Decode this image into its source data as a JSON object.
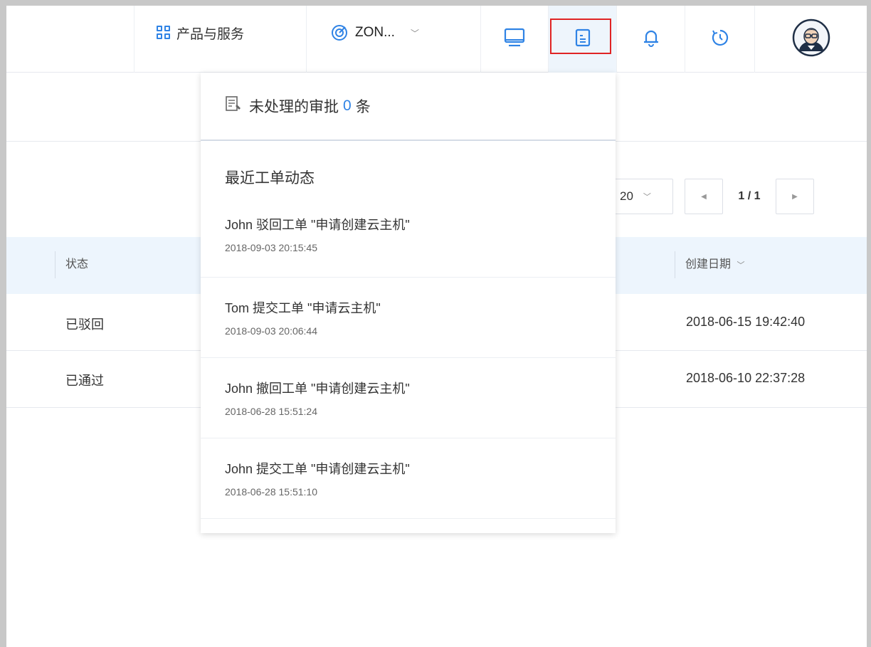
{
  "header": {
    "products_label": "产品与服务",
    "zone_label": "ZON...",
    "icons": [
      "grid-icon",
      "zone-icon",
      "monitor-icon",
      "ticket-icon",
      "bell-icon",
      "history-icon",
      "avatar"
    ]
  },
  "approvals": {
    "prefix": "未处理的审批",
    "count": "0",
    "suffix": "条"
  },
  "recent": {
    "title": "最近工单动态",
    "items": [
      {
        "message": "John 驳回工单 \"申请创建云主机\"",
        "time": "2018-09-03 20:15:45"
      },
      {
        "message": "Tom 提交工单 \"申请云主机\"",
        "time": "2018-09-03 20:06:44"
      },
      {
        "message": "John 撤回工单 \"申请创建云主机\"",
        "time": "2018-06-28 15:51:24"
      },
      {
        "message": "John 提交工单 \"申请创建云主机\"",
        "time": "2018-06-28 15:51:10"
      }
    ]
  },
  "pager": {
    "page_size": "20",
    "page_text": "1 / 1"
  },
  "table": {
    "col_status": "状态",
    "col_created": "创建日期",
    "rows": [
      {
        "status": "已驳回",
        "created": "2018-06-15 19:42:40"
      },
      {
        "status": "已通过",
        "created": "2018-06-10 22:37:28"
      }
    ]
  },
  "colors": {
    "accent": "#2f83e5",
    "highlight_border": "#e02424",
    "table_header_bg": "#edf5fd"
  }
}
